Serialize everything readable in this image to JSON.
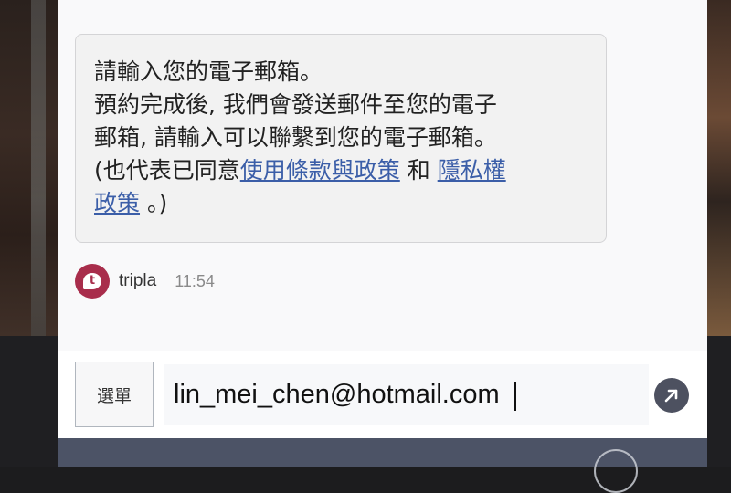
{
  "chat": {
    "message": {
      "line1": "請輸入您的電子郵箱。",
      "line2": "預約完成後, 我們會發送郵件至您的電子",
      "line3": "郵箱, 請輸入可以聯繫到您的電子郵箱。",
      "line4_prefix": "(也代表已同意",
      "terms_link": "使用條款與政策",
      "conjunction": " 和 ",
      "privacy_link_part1": "隱私權",
      "privacy_link_part2": "政策",
      "line5_suffix": " 。)"
    },
    "sender": {
      "name": "tripla",
      "avatar_letter": "t",
      "time": "11:54"
    }
  },
  "input_bar": {
    "menu_label": "選單",
    "email_value": "lin_mei_chen@hotmail.com"
  },
  "icons": {
    "send": "arrow-up-right-icon",
    "avatar": "tripla-logo-icon"
  },
  "colors": {
    "brand": "#a82d4b",
    "link": "#3b5ea8",
    "send_button": "#4d5160",
    "bottom_strip": "#4c5366"
  }
}
